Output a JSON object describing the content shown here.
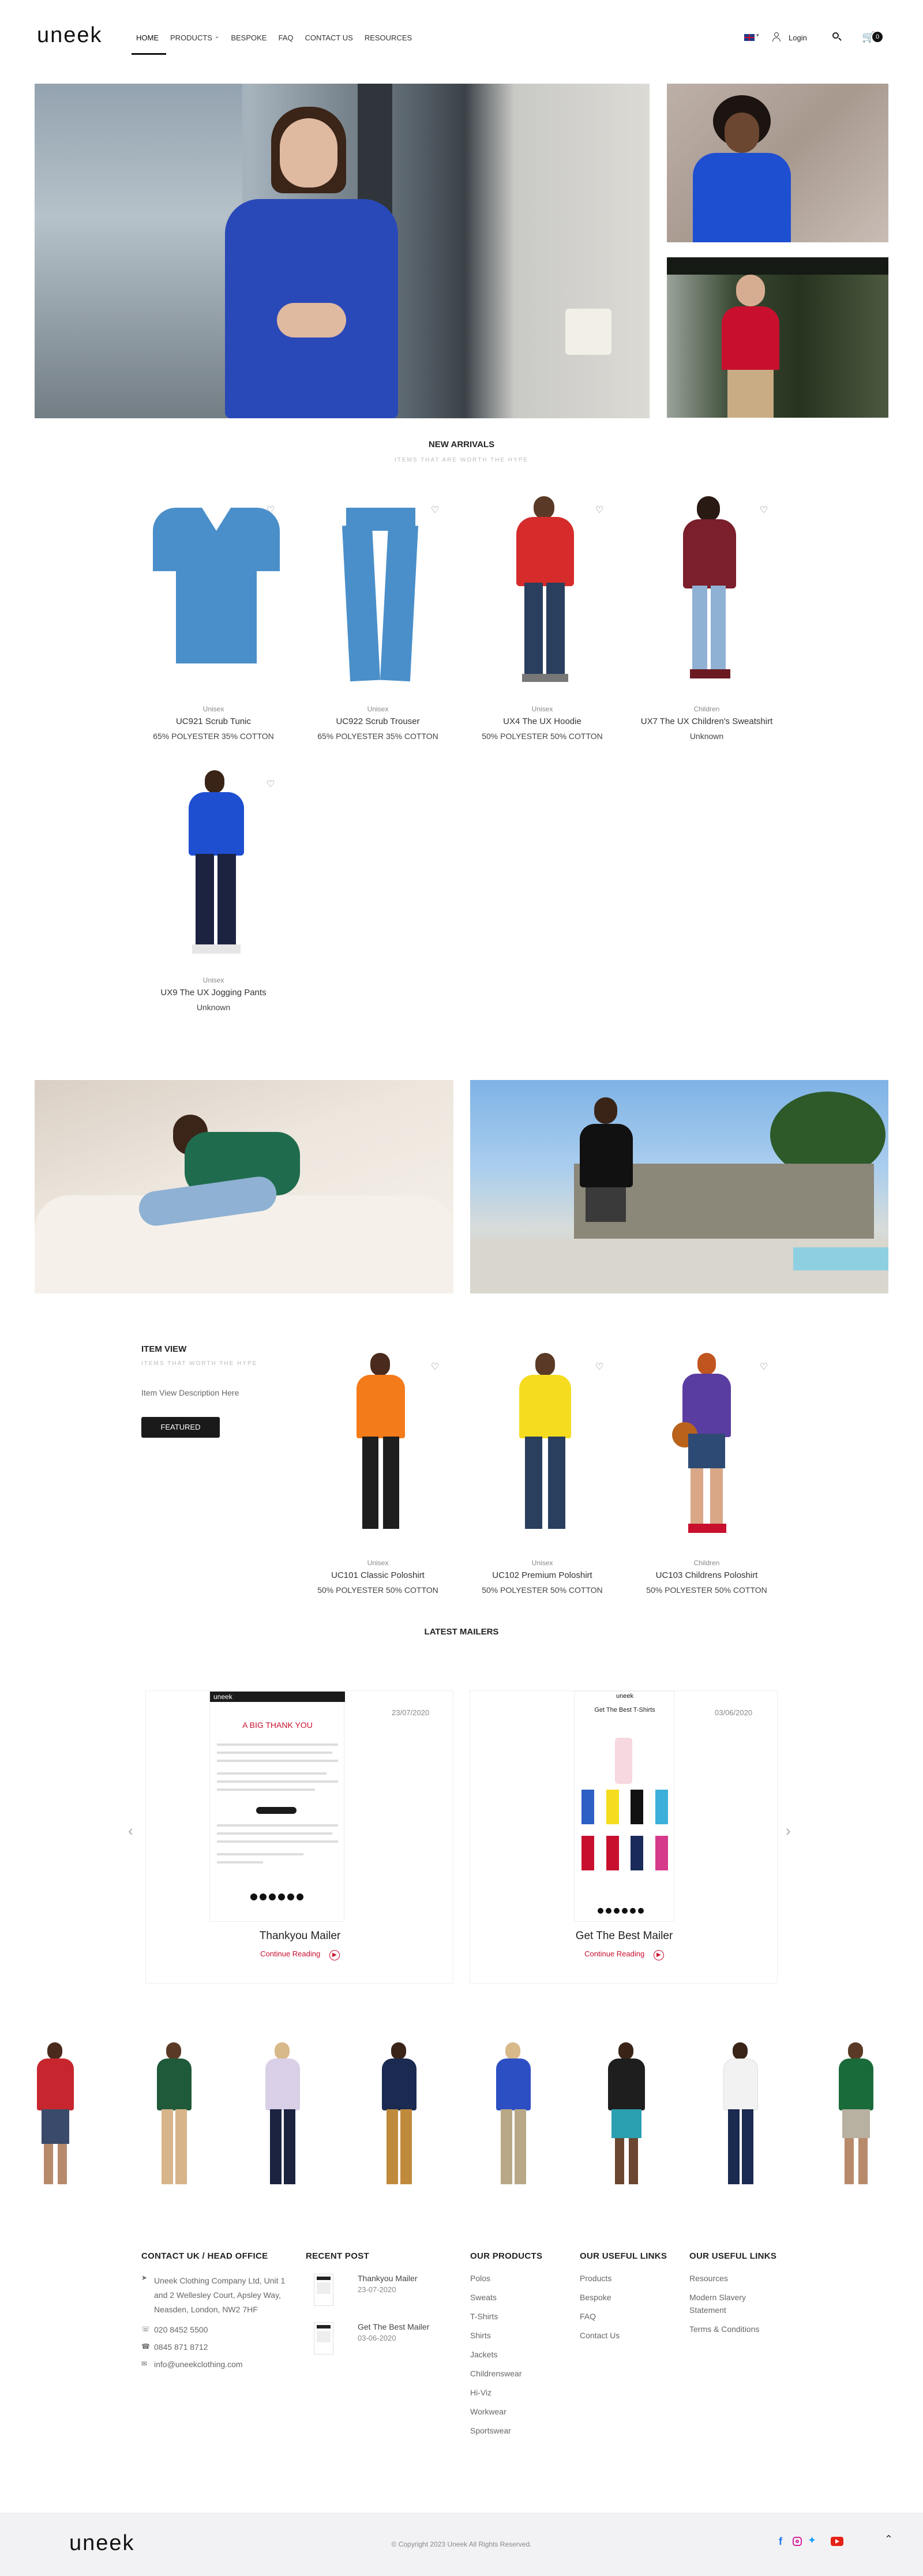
{
  "header": {
    "logo": "uneek",
    "nav": [
      "HOME",
      "PRODUCTS",
      "BESPOKE",
      "FAQ",
      "CONTACT US",
      "RESOURCES"
    ],
    "login": "Login",
    "cart_count": "0",
    "icons": {
      "flag": "uk-flag-icon",
      "user": "user-icon",
      "search": "search-icon",
      "cart": "cart-icon"
    }
  },
  "new_arrivals": {
    "title": "NEW ARRIVALS",
    "subtitle": "ITEMS THAT ARE WORTH THE HYPE",
    "products": [
      {
        "category": "Unisex",
        "name": "UC921 Scrub Tunic",
        "material": "65% POLYESTER 35% COTTON"
      },
      {
        "category": "Unisex",
        "name": "UC922 Scrub Trouser",
        "material": "65% POLYESTER 35% COTTON"
      },
      {
        "category": "Unisex",
        "name": "UX4 The UX Hoodie",
        "material": "50% POLYESTER 50% COTTON"
      },
      {
        "category": "Children",
        "name": "UX7 The UX Children's Sweatshirt",
        "material": "Unknown"
      },
      {
        "category": "Unisex",
        "name": "UX9 The UX Jogging Pants",
        "material": "Unknown"
      }
    ]
  },
  "item_view": {
    "title": "ITEM VIEW",
    "subtitle": "ITEMS THAT WORTH THE HYPE",
    "description": "Item View Description Here",
    "button": "FEATURED",
    "products": [
      {
        "category": "Unisex",
        "name": "UC101 Classic Poloshirt",
        "material": "50% POLYESTER 50% COTTON"
      },
      {
        "category": "Unisex",
        "name": "UC102 Premium Poloshirt",
        "material": "50% POLYESTER 50% COTTON"
      },
      {
        "category": "Children",
        "name": "UC103 Childrens Poloshirt",
        "material": "50% POLYESTER 50% COTTON"
      }
    ]
  },
  "mailers": {
    "title": "LATEST MAILERS",
    "items": [
      {
        "date": "23/07/2020",
        "title": "Thankyou Mailer",
        "link": "Continue Reading",
        "thumb_heading": "A BIG THANK YOU",
        "thumb_logo": "uneek"
      },
      {
        "date": "03/06/2020",
        "title": "Get The Best Mailer",
        "link": "Continue Reading",
        "thumb_heading": "Get The Best T-Shirts",
        "thumb_logo": "uneek"
      }
    ]
  },
  "footer": {
    "contact": {
      "title": "CONTACT UK / HEAD OFFICE",
      "address": "Uneek Clothing Company Ltd, Unit 1 and 2 Wellesley Court, Apsley Way, Neasden, London, NW2 7HF",
      "phone1": "020 8452 5500",
      "phone2": "0845 871 8712",
      "email": "info@uneekclothing.com"
    },
    "recent": {
      "title": "RECENT POST",
      "posts": [
        {
          "title": "Thankyou Mailer",
          "date": "23-07-2020"
        },
        {
          "title": "Get The Best Mailer",
          "date": "03-06-2020"
        }
      ]
    },
    "products": {
      "title": "OUR PRODUCTS",
      "links": [
        "Polos",
        "Sweats",
        "T-Shirts",
        "Shirts",
        "Jackets",
        "Childrenswear",
        "Hi-Viz",
        "Workwear",
        "Sportswear"
      ]
    },
    "useful1": {
      "title": "OUR USEFUL LINKS",
      "links": [
        "Products",
        "Bespoke",
        "FAQ",
        "Contact Us"
      ]
    },
    "useful2": {
      "title": "OUR USEFUL LINKS",
      "links": [
        "Resources",
        "Modern Slavery Statement",
        "Terms & Conditions"
      ]
    }
  },
  "bottom": {
    "logo": "uneek",
    "copyright": "© Copyright 2023 Uneek All Rights Reserved."
  },
  "colors": {
    "accent": "#c8102e",
    "dark": "#1a1a1a",
    "blue": "#2d5fc4"
  }
}
